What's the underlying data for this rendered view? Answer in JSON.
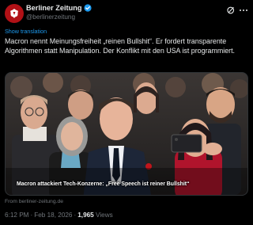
{
  "account": {
    "display_name": "Berliner Zeitung",
    "handle": "@berlinerzeitung",
    "avatar_icon": "berliner-zeitung-logo",
    "verified": true,
    "brand_color": "#b11116",
    "verified_color": "#1d9bf0"
  },
  "actions": {
    "grok_icon": "grok-icon",
    "more_icon": "more-icon"
  },
  "translate_label": "Show translation",
  "post_text": "Macron nennt Meinungsfreiheit „reinen Bullshit“. Er fordert transparente Algorithmen statt Manipulation. Der Konflikt mit den USA ist programmiert.",
  "media": {
    "caption": "Macron attackiert Tech-Konzerne: „Free Speech ist reiner Bullshit“"
  },
  "link_source": "From berliner-zeitung.de",
  "meta": {
    "time": "6:12 PM",
    "date": "Feb 18, 2026",
    "views_count": "1,965",
    "views_label": "Views",
    "separator": "·"
  }
}
